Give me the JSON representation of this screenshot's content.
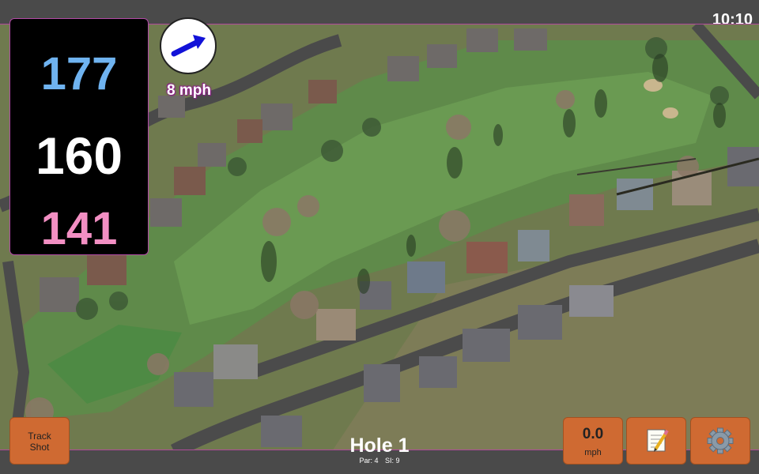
{
  "status": {
    "time": "10:10"
  },
  "distances": {
    "back": "177",
    "center": "160",
    "front": "141"
  },
  "wind": {
    "speed": "8 mph",
    "icon": "wind-arrow-icon"
  },
  "hole": {
    "title": "Hole 1",
    "par": "Par: 4",
    "si": "SI: 9"
  },
  "buttons": {
    "track_line1": "Track",
    "track_line2": "Shot",
    "speed_value": "0.0",
    "speed_unit": "mph",
    "notes_icon": "notepad-icon",
    "settings_icon": "gear-icon"
  },
  "colors": {
    "accent": "#cf6a32",
    "back_distance": "#6fb3f0",
    "front_distance": "#f28fc3",
    "panel_border": "#b24aa6"
  }
}
